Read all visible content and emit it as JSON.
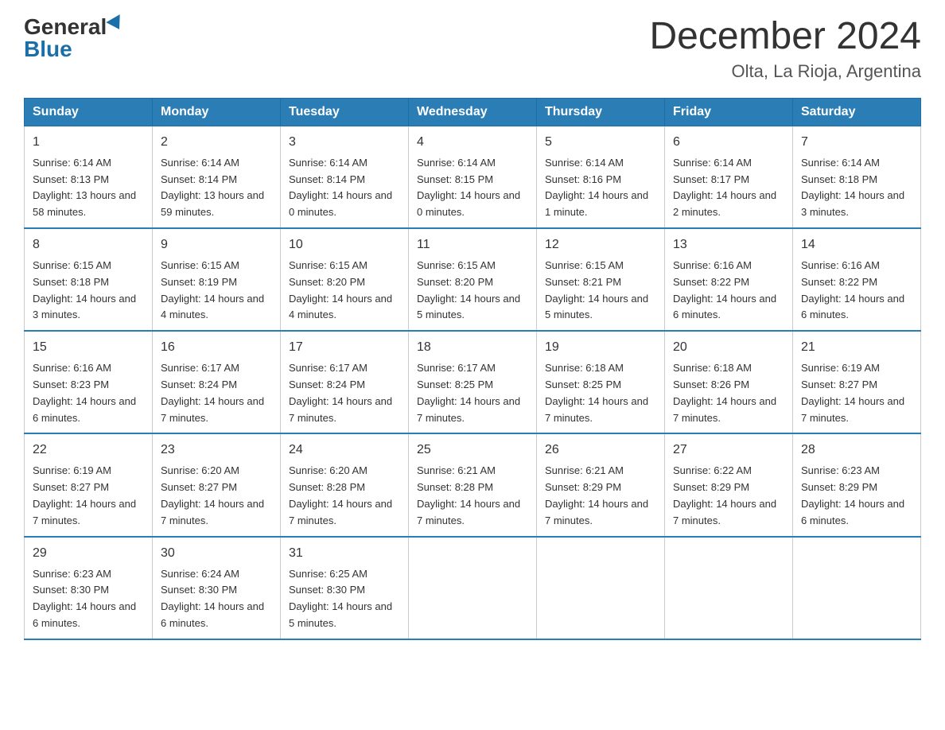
{
  "logo": {
    "general": "General",
    "blue": "Blue"
  },
  "title": "December 2024",
  "location": "Olta, La Rioja, Argentina",
  "headers": [
    "Sunday",
    "Monday",
    "Tuesday",
    "Wednesday",
    "Thursday",
    "Friday",
    "Saturday"
  ],
  "weeks": [
    [
      {
        "day": "1",
        "sunrise": "6:14 AM",
        "sunset": "8:13 PM",
        "daylight": "13 hours and 58 minutes."
      },
      {
        "day": "2",
        "sunrise": "6:14 AM",
        "sunset": "8:14 PM",
        "daylight": "13 hours and 59 minutes."
      },
      {
        "day": "3",
        "sunrise": "6:14 AM",
        "sunset": "8:14 PM",
        "daylight": "14 hours and 0 minutes."
      },
      {
        "day": "4",
        "sunrise": "6:14 AM",
        "sunset": "8:15 PM",
        "daylight": "14 hours and 0 minutes."
      },
      {
        "day": "5",
        "sunrise": "6:14 AM",
        "sunset": "8:16 PM",
        "daylight": "14 hours and 1 minute."
      },
      {
        "day": "6",
        "sunrise": "6:14 AM",
        "sunset": "8:17 PM",
        "daylight": "14 hours and 2 minutes."
      },
      {
        "day": "7",
        "sunrise": "6:14 AM",
        "sunset": "8:18 PM",
        "daylight": "14 hours and 3 minutes."
      }
    ],
    [
      {
        "day": "8",
        "sunrise": "6:15 AM",
        "sunset": "8:18 PM",
        "daylight": "14 hours and 3 minutes."
      },
      {
        "day": "9",
        "sunrise": "6:15 AM",
        "sunset": "8:19 PM",
        "daylight": "14 hours and 4 minutes."
      },
      {
        "day": "10",
        "sunrise": "6:15 AM",
        "sunset": "8:20 PM",
        "daylight": "14 hours and 4 minutes."
      },
      {
        "day": "11",
        "sunrise": "6:15 AM",
        "sunset": "8:20 PM",
        "daylight": "14 hours and 5 minutes."
      },
      {
        "day": "12",
        "sunrise": "6:15 AM",
        "sunset": "8:21 PM",
        "daylight": "14 hours and 5 minutes."
      },
      {
        "day": "13",
        "sunrise": "6:16 AM",
        "sunset": "8:22 PM",
        "daylight": "14 hours and 6 minutes."
      },
      {
        "day": "14",
        "sunrise": "6:16 AM",
        "sunset": "8:22 PM",
        "daylight": "14 hours and 6 minutes."
      }
    ],
    [
      {
        "day": "15",
        "sunrise": "6:16 AM",
        "sunset": "8:23 PM",
        "daylight": "14 hours and 6 minutes."
      },
      {
        "day": "16",
        "sunrise": "6:17 AM",
        "sunset": "8:24 PM",
        "daylight": "14 hours and 7 minutes."
      },
      {
        "day": "17",
        "sunrise": "6:17 AM",
        "sunset": "8:24 PM",
        "daylight": "14 hours and 7 minutes."
      },
      {
        "day": "18",
        "sunrise": "6:17 AM",
        "sunset": "8:25 PM",
        "daylight": "14 hours and 7 minutes."
      },
      {
        "day": "19",
        "sunrise": "6:18 AM",
        "sunset": "8:25 PM",
        "daylight": "14 hours and 7 minutes."
      },
      {
        "day": "20",
        "sunrise": "6:18 AM",
        "sunset": "8:26 PM",
        "daylight": "14 hours and 7 minutes."
      },
      {
        "day": "21",
        "sunrise": "6:19 AM",
        "sunset": "8:27 PM",
        "daylight": "14 hours and 7 minutes."
      }
    ],
    [
      {
        "day": "22",
        "sunrise": "6:19 AM",
        "sunset": "8:27 PM",
        "daylight": "14 hours and 7 minutes."
      },
      {
        "day": "23",
        "sunrise": "6:20 AM",
        "sunset": "8:27 PM",
        "daylight": "14 hours and 7 minutes."
      },
      {
        "day": "24",
        "sunrise": "6:20 AM",
        "sunset": "8:28 PM",
        "daylight": "14 hours and 7 minutes."
      },
      {
        "day": "25",
        "sunrise": "6:21 AM",
        "sunset": "8:28 PM",
        "daylight": "14 hours and 7 minutes."
      },
      {
        "day": "26",
        "sunrise": "6:21 AM",
        "sunset": "8:29 PM",
        "daylight": "14 hours and 7 minutes."
      },
      {
        "day": "27",
        "sunrise": "6:22 AM",
        "sunset": "8:29 PM",
        "daylight": "14 hours and 7 minutes."
      },
      {
        "day": "28",
        "sunrise": "6:23 AM",
        "sunset": "8:29 PM",
        "daylight": "14 hours and 6 minutes."
      }
    ],
    [
      {
        "day": "29",
        "sunrise": "6:23 AM",
        "sunset": "8:30 PM",
        "daylight": "14 hours and 6 minutes."
      },
      {
        "day": "30",
        "sunrise": "6:24 AM",
        "sunset": "8:30 PM",
        "daylight": "14 hours and 6 minutes."
      },
      {
        "day": "31",
        "sunrise": "6:25 AM",
        "sunset": "8:30 PM",
        "daylight": "14 hours and 5 minutes."
      },
      null,
      null,
      null,
      null
    ]
  ]
}
